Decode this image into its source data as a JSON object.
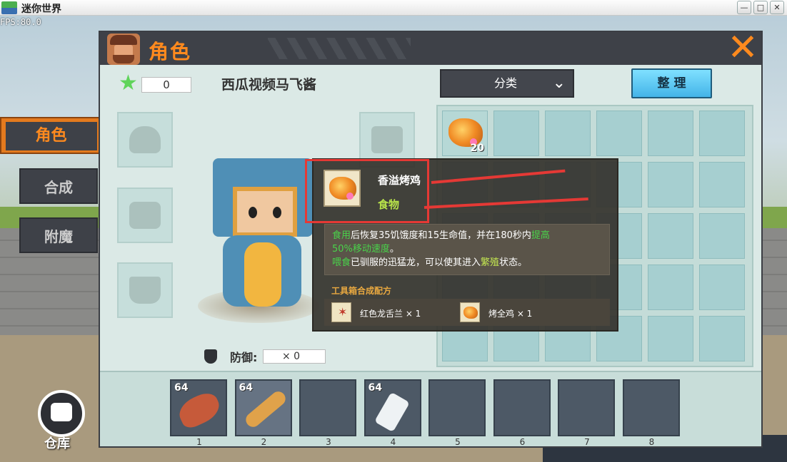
{
  "window": {
    "title": "迷你世界",
    "fps": "FPS:80.0",
    "min": "—",
    "max": "□",
    "close": "✕"
  },
  "header": {
    "title": "角色",
    "close_symbol": "✕"
  },
  "sidebar": {
    "items": [
      {
        "label": "角色",
        "active": true
      },
      {
        "label": "合成",
        "active": false
      },
      {
        "label": "附魔",
        "active": false
      }
    ]
  },
  "player": {
    "star_count": "0",
    "name": "西瓜视频马飞酱",
    "defense_label": "防御:",
    "defense_value": "× 0"
  },
  "controls": {
    "category_label": "分类",
    "sort_label": "整 理"
  },
  "inventory": {
    "first_item_count": "20"
  },
  "tooltip": {
    "name": "香溢烤鸡",
    "type": "食物",
    "desc_1_green": "食用",
    "desc_1_text": "后恢复35饥饿度和15生命值，并在180秒内",
    "desc_1_green2": "提高",
    "desc_2_green": "50%移动速度",
    "desc_2_text": "。",
    "desc_3_green": "喂食",
    "desc_3_text": "已驯服的迅猛龙，可以使其进入",
    "desc_3_yellow": "繁殖",
    "desc_3_text2": "状态。",
    "recipe_title": "工具箱合成配方",
    "ingredients": [
      {
        "name": "红色龙舌兰 × 1"
      },
      {
        "name": "烤全鸡 × 1"
      }
    ]
  },
  "hotbar": {
    "slots": [
      {
        "num": "1",
        "count": "64",
        "item": "meat-icon"
      },
      {
        "num": "2",
        "count": "64",
        "item": "bread-icon"
      },
      {
        "num": "3",
        "count": "",
        "item": ""
      },
      {
        "num": "4",
        "count": "64",
        "item": "milk-icon"
      },
      {
        "num": "5",
        "count": "",
        "item": ""
      },
      {
        "num": "6",
        "count": "",
        "item": ""
      },
      {
        "num": "7",
        "count": "",
        "item": ""
      },
      {
        "num": "8",
        "count": "",
        "item": ""
      }
    ],
    "storage_label": "仓库"
  },
  "colors": {
    "accent": "#ff8a1e",
    "highlight_box": "#e53935",
    "food_green": "#49d24a",
    "food_type": "#b8e34a"
  }
}
